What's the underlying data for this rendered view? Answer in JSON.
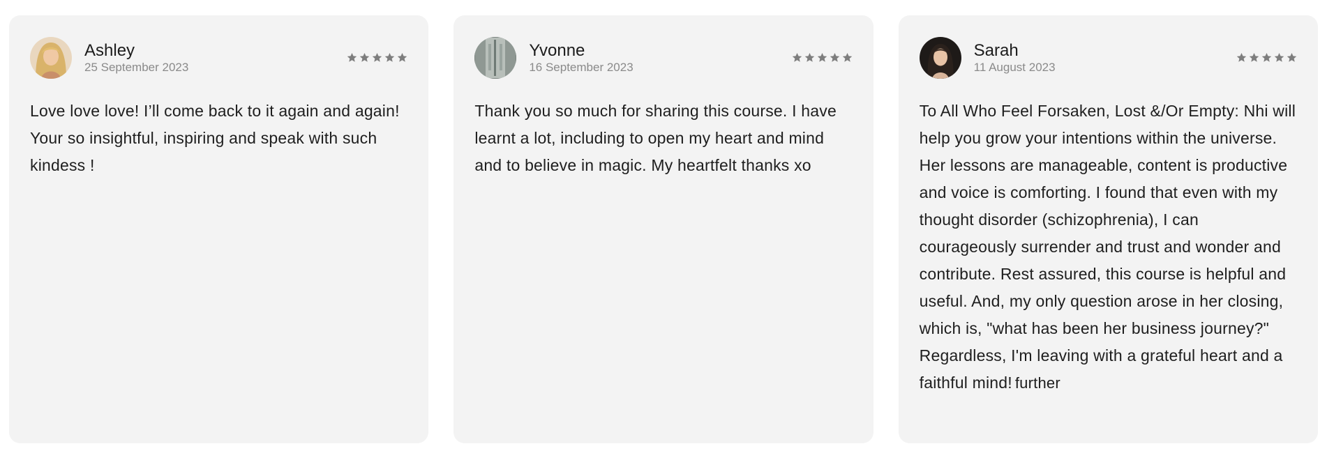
{
  "colors": {
    "card_background": "#f3f3f3",
    "star": "#7d7d7d",
    "date_text": "#8a8a8a",
    "body_text": "#1e1e1e"
  },
  "reviews": [
    {
      "name": "Ashley",
      "date": "25 September 2023",
      "rating": 5,
      "rating_max": 5,
      "text": "Love love love! I’ll come back to it again and again! Your so insightful, inspiring and speak with such kindess !"
    },
    {
      "name": "Yvonne",
      "date": "16 September 2023",
      "rating": 5,
      "rating_max": 5,
      "text": "Thank you so much for sharing this course. I have learnt a lot, including to open my heart and mind and to believe in magic. My heartfelt thanks xo"
    },
    {
      "name": "Sarah",
      "date": "11 August 2023",
      "rating": 5,
      "rating_max": 5,
      "text": "To All Who Feel Forsaken, Lost &/Or Empty: Nhi will help you grow your intentions within the universe. Her lessons are manageable, content is productive and voice is comforting. I found that even with my thought disorder (schizophrenia), I can courageously surrender and trust and wonder and contribute. Rest assured, this course is helpful and useful. And, my only question arose in her closing, which is, \"what has been her business journey?\" Regardless, I'm leaving with a grateful heart and a faithful mind!",
      "more_label": "further"
    }
  ]
}
